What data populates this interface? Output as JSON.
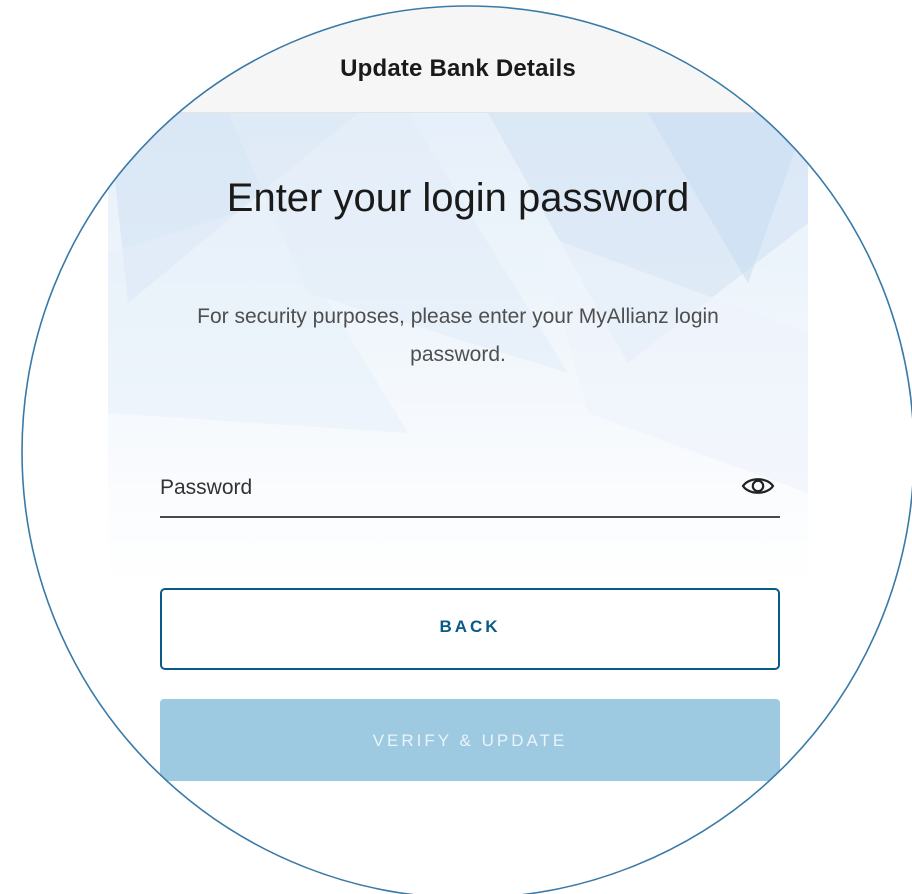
{
  "header": {
    "title": "Update Bank Details"
  },
  "main": {
    "heading": "Enter your login password",
    "description": "For security purposes, please enter your MyAllianz login password."
  },
  "form": {
    "password_label": "Password",
    "toggle_icon": "eye-icon"
  },
  "actions": {
    "back_label": "BACK",
    "verify_label": "VERIFY & UPDATE",
    "verify_enabled": false
  },
  "colors": {
    "accent": "#0a5a88",
    "disabled_button": "#9ecae1",
    "circle_frame": "#3a7aa8"
  }
}
